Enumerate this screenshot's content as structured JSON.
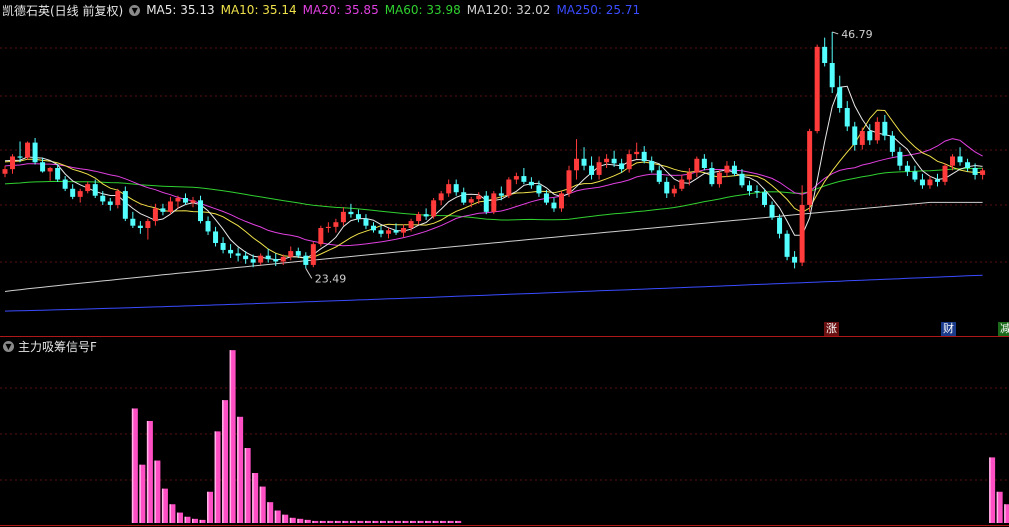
{
  "header": {
    "stock_name": "凯德石英(日线 前复权)",
    "ma_items": [
      {
        "label": "MA5: 35.13",
        "color": "#e8e8e8"
      },
      {
        "label": "MA10: 35.14",
        "color": "#f0e14a"
      },
      {
        "label": "MA20: 35.85",
        "color": "#e040e0"
      },
      {
        "label": "MA60: 33.98",
        "color": "#30d030"
      },
      {
        "label": "MA120: 32.02",
        "color": "#cfcfcf"
      },
      {
        "label": "MA250: 25.71",
        "color": "#3a4cff"
      }
    ]
  },
  "price_panel": {
    "high_label": "46.79",
    "low_label": "23.49",
    "up_color": "#ff3b3b",
    "down_color": "#54ffff"
  },
  "events": [
    {
      "label": "涨",
      "bg": "#6a1010",
      "x": 826
    },
    {
      "label": "财",
      "bg": "#1a3a8a",
      "x": 943
    },
    {
      "label": "减",
      "bg": "#1a6a1a",
      "x": 1000
    }
  ],
  "indicator": {
    "title": "主力吸筹信号F",
    "bar_color": "#ff4fc4"
  },
  "chart_data": {
    "type": "candlestick",
    "title": "凯德石英(日线 前复权)",
    "price_range": [
      22,
      48
    ],
    "candles": [
      [
        34.5,
        35.2,
        34.2,
        34.9
      ],
      [
        34.9,
        36.2,
        34.5,
        36.0
      ],
      [
        36.0,
        37.3,
        35.5,
        35.9
      ],
      [
        35.9,
        37.3,
        35.7,
        37.2
      ],
      [
        37.2,
        37.6,
        35.3,
        35.5
      ],
      [
        35.5,
        35.9,
        34.6,
        34.7
      ],
      [
        34.7,
        35.1,
        33.9,
        35.0
      ],
      [
        35.0,
        35.3,
        33.8,
        34.0
      ],
      [
        34.0,
        34.3,
        33.0,
        33.2
      ],
      [
        33.2,
        33.6,
        32.3,
        32.5
      ],
      [
        32.5,
        33.2,
        32.0,
        33.0
      ],
      [
        33.0,
        33.8,
        32.8,
        33.6
      ],
      [
        33.6,
        34.0,
        32.4,
        32.6
      ],
      [
        32.6,
        33.0,
        31.8,
        32.1
      ],
      [
        32.1,
        32.4,
        31.3,
        31.8
      ],
      [
        31.8,
        33.2,
        31.5,
        33.0
      ],
      [
        33.0,
        33.4,
        30.4,
        30.6
      ],
      [
        30.6,
        31.2,
        29.8,
        30.0
      ],
      [
        30.0,
        30.4,
        29.3,
        29.8
      ],
      [
        29.8,
        30.6,
        28.8,
        30.4
      ],
      [
        30.4,
        31.9,
        30.0,
        31.5
      ],
      [
        31.5,
        31.9,
        30.9,
        31.2
      ],
      [
        31.2,
        32.5,
        31.0,
        32.1
      ],
      [
        32.1,
        32.6,
        31.5,
        32.4
      ],
      [
        32.4,
        32.8,
        31.8,
        32.0
      ],
      [
        32.0,
        32.5,
        31.6,
        32.2
      ],
      [
        32.2,
        32.6,
        30.2,
        30.4
      ],
      [
        30.4,
        30.8,
        29.2,
        29.5
      ],
      [
        29.5,
        29.9,
        28.2,
        28.5
      ],
      [
        28.5,
        29.0,
        27.6,
        27.9
      ],
      [
        27.9,
        28.4,
        27.2,
        27.6
      ],
      [
        27.6,
        28.1,
        26.9,
        27.4
      ],
      [
        27.4,
        27.8,
        26.7,
        27.1
      ],
      [
        27.1,
        27.5,
        26.4,
        26.8
      ],
      [
        26.8,
        27.6,
        26.6,
        27.4
      ],
      [
        27.4,
        28.0,
        26.8,
        27.1
      ],
      [
        27.1,
        27.6,
        26.5,
        26.9
      ],
      [
        26.9,
        27.5,
        26.6,
        27.3
      ],
      [
        27.3,
        28.2,
        27.0,
        27.8
      ],
      [
        27.8,
        28.1,
        27.2,
        27.4
      ],
      [
        27.4,
        27.7,
        26.3,
        26.6
      ],
      [
        26.6,
        28.6,
        26.4,
        28.4
      ],
      [
        28.4,
        30.0,
        28.2,
        29.8
      ],
      [
        29.8,
        30.3,
        29.4,
        29.9
      ],
      [
        29.9,
        30.6,
        29.4,
        30.3
      ],
      [
        30.3,
        31.6,
        30.0,
        31.2
      ],
      [
        31.2,
        31.9,
        30.7,
        31.0
      ],
      [
        31.0,
        31.4,
        30.3,
        30.6
      ],
      [
        30.6,
        31.0,
        29.7,
        30.0
      ],
      [
        30.0,
        30.3,
        29.4,
        29.6
      ],
      [
        29.6,
        30.0,
        29.0,
        29.3
      ],
      [
        29.3,
        29.8,
        28.9,
        29.6
      ],
      [
        29.6,
        30.2,
        29.2,
        29.4
      ],
      [
        29.4,
        30.1,
        29.0,
        29.8
      ],
      [
        29.8,
        30.6,
        29.5,
        30.4
      ],
      [
        30.4,
        31.2,
        30.1,
        31.0
      ],
      [
        31.0,
        31.5,
        30.5,
        30.8
      ],
      [
        30.8,
        32.4,
        30.6,
        32.2
      ],
      [
        32.2,
        33.0,
        31.8,
        32.8
      ],
      [
        32.8,
        34.0,
        32.5,
        33.6
      ],
      [
        33.6,
        34.0,
        32.6,
        32.9
      ],
      [
        32.9,
        33.3,
        31.8,
        32.0
      ],
      [
        32.0,
        32.5,
        31.6,
        32.3
      ],
      [
        32.3,
        32.9,
        31.9,
        32.6
      ],
      [
        32.6,
        33.0,
        31.0,
        31.2
      ],
      [
        31.2,
        33.0,
        31.0,
        32.8
      ],
      [
        32.8,
        33.4,
        32.2,
        32.6
      ],
      [
        32.6,
        34.2,
        32.4,
        34.0
      ],
      [
        34.0,
        34.6,
        33.6,
        34.3
      ],
      [
        34.3,
        35.0,
        33.6,
        33.8
      ],
      [
        33.8,
        34.2,
        33.2,
        33.5
      ],
      [
        33.5,
        33.9,
        32.5,
        32.8
      ],
      [
        32.8,
        33.1,
        31.8,
        32.0
      ],
      [
        32.0,
        32.4,
        31.2,
        31.5
      ],
      [
        31.5,
        33.0,
        31.2,
        32.8
      ],
      [
        32.8,
        35.2,
        32.5,
        34.8
      ],
      [
        34.8,
        37.5,
        34.0,
        35.8
      ],
      [
        35.8,
        36.8,
        34.8,
        35.2
      ],
      [
        35.2,
        36.0,
        34.0,
        34.4
      ],
      [
        34.4,
        36.0,
        34.0,
        35.5
      ],
      [
        35.5,
        36.2,
        35.0,
        35.8
      ],
      [
        35.8,
        36.5,
        35.1,
        35.4
      ],
      [
        35.4,
        35.8,
        34.6,
        34.9
      ],
      [
        34.9,
        36.6,
        34.6,
        36.2
      ],
      [
        36.2,
        37.2,
        35.8,
        36.4
      ],
      [
        36.4,
        36.9,
        35.4,
        35.6
      ],
      [
        35.6,
        36.0,
        34.6,
        34.8
      ],
      [
        34.8,
        35.2,
        33.6,
        33.8
      ],
      [
        33.8,
        34.2,
        32.4,
        32.8
      ],
      [
        32.8,
        33.5,
        32.5,
        33.2
      ],
      [
        33.2,
        34.4,
        33.0,
        34.0
      ],
      [
        34.0,
        35.0,
        33.5,
        34.6
      ],
      [
        34.6,
        36.0,
        34.2,
        35.8
      ],
      [
        35.8,
        36.2,
        34.8,
        35.0
      ],
      [
        35.0,
        35.5,
        33.4,
        33.6
      ],
      [
        33.6,
        34.8,
        33.3,
        34.6
      ],
      [
        34.6,
        35.6,
        34.2,
        35.2
      ],
      [
        35.2,
        35.6,
        34.3,
        34.5
      ],
      [
        34.5,
        34.9,
        33.3,
        33.5
      ],
      [
        33.5,
        33.9,
        32.6,
        33.0
      ],
      [
        33.0,
        33.5,
        32.4,
        32.9
      ],
      [
        32.9,
        33.2,
        31.6,
        31.8
      ],
      [
        31.8,
        32.1,
        30.5,
        30.7
      ],
      [
        30.7,
        31.0,
        28.9,
        29.3
      ],
      [
        29.3,
        29.6,
        27.0,
        27.3
      ],
      [
        27.3,
        27.8,
        26.3,
        26.8
      ],
      [
        26.8,
        33.5,
        26.5,
        31.8
      ],
      [
        31.8,
        38.4,
        31.2,
        38.2
      ],
      [
        38.2,
        45.7,
        38.0,
        45.5
      ],
      [
        45.5,
        46.3,
        43.8,
        44.1
      ],
      [
        44.1,
        46.79,
        41.5,
        42.0
      ],
      [
        42.0,
        43.0,
        39.8,
        40.2
      ],
      [
        40.2,
        40.8,
        38.2,
        38.6
      ],
      [
        38.6,
        39.0,
        36.5,
        37.0
      ],
      [
        37.0,
        38.5,
        36.6,
        38.2
      ],
      [
        38.2,
        38.8,
        37.0,
        37.4
      ],
      [
        37.4,
        39.4,
        37.1,
        39.0
      ],
      [
        39.0,
        39.6,
        37.4,
        37.8
      ],
      [
        37.8,
        38.2,
        36.0,
        36.4
      ],
      [
        36.4,
        36.8,
        34.8,
        35.2
      ],
      [
        35.2,
        35.6,
        34.3,
        34.7
      ],
      [
        34.7,
        35.2,
        33.8,
        34.0
      ],
      [
        34.0,
        34.5,
        33.2,
        33.5
      ],
      [
        33.5,
        34.3,
        33.2,
        34.0
      ],
      [
        34.0,
        34.5,
        33.4,
        33.8
      ],
      [
        33.8,
        35.4,
        33.5,
        35.2
      ],
      [
        35.2,
        36.2,
        34.8,
        36.0
      ],
      [
        36.0,
        36.8,
        35.2,
        35.5
      ],
      [
        35.5,
        35.8,
        34.7,
        35.0
      ],
      [
        35.0,
        35.4,
        34.0,
        34.4
      ],
      [
        34.4,
        35.0,
        34.0,
        34.8
      ]
    ],
    "ma_series": [
      "MA5",
      "MA10",
      "MA20",
      "MA60",
      "MA120",
      "MA250"
    ],
    "indicator": {
      "title": "主力吸筹信号F",
      "series": [
        {
          "start_index": 17,
          "values": [
            110,
            56,
            98,
            60,
            33,
            18,
            10,
            6,
            4,
            3,
            30,
            88,
            118,
            166,
            102,
            72,
            48,
            35,
            20,
            12,
            8,
            5,
            4,
            3,
            2,
            2,
            2,
            2,
            2,
            2,
            2,
            2,
            2,
            2,
            2,
            2,
            2,
            2,
            2,
            2,
            2,
            2,
            2,
            2
          ]
        },
        {
          "start_index": 131,
          "values": [
            63,
            30,
            18,
            11,
            8,
            6,
            5,
            4,
            3,
            3,
            3,
            3,
            3,
            2,
            2,
            2,
            2,
            2,
            2,
            2,
            2,
            2,
            2,
            2
          ]
        }
      ]
    }
  }
}
